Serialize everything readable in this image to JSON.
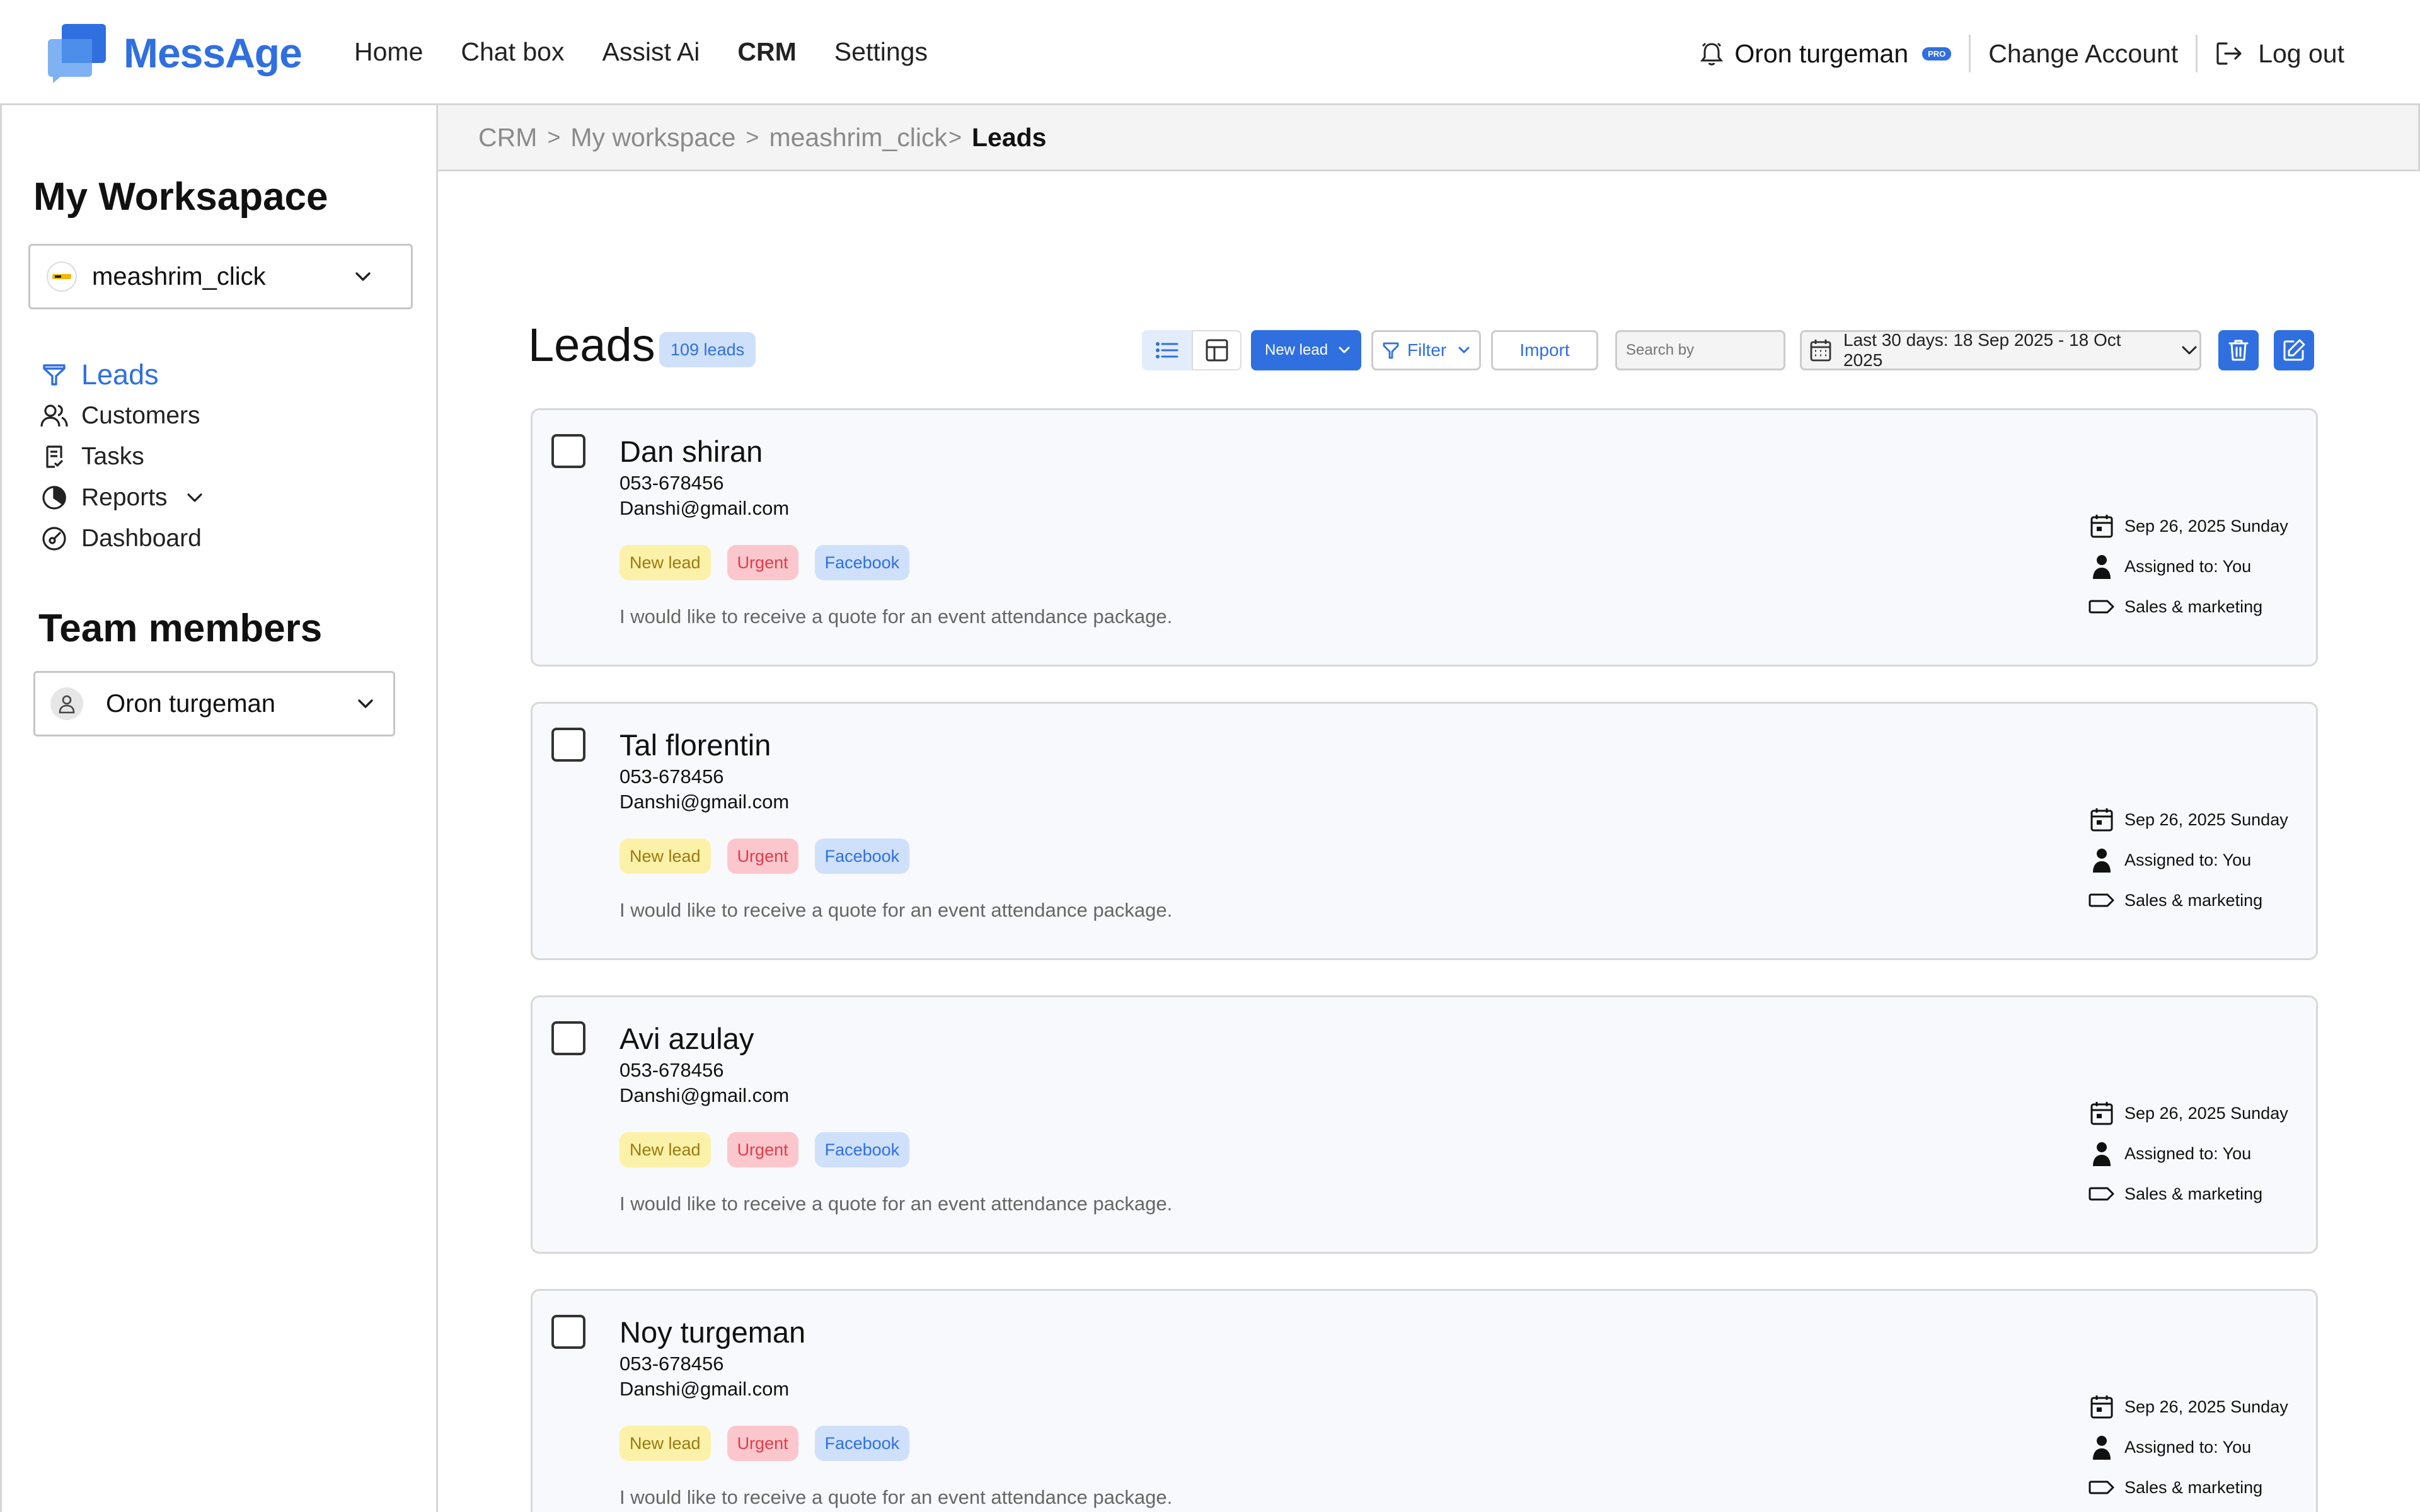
{
  "app": {
    "name": "MessAge",
    "brand_color": "#2f6fe0"
  },
  "nav": {
    "items": [
      {
        "label": "Home"
      },
      {
        "label": "Chat box"
      },
      {
        "label": "Assist Ai"
      },
      {
        "label": "CRM",
        "active": true
      },
      {
        "label": "Settings"
      }
    ]
  },
  "header": {
    "user_name": "Oron turgeman",
    "badge": "PRO",
    "change_account": "Change Account",
    "logout": "Log out"
  },
  "sidebar": {
    "workspace_title": "My Worksapace",
    "workspace_selected": "meashrim_click",
    "items": [
      {
        "label": "Leads",
        "icon": "funnel-icon",
        "active": true
      },
      {
        "label": "Customers",
        "icon": "users-icon"
      },
      {
        "label": "Tasks",
        "icon": "clipboard-icon"
      },
      {
        "label": "Reports",
        "icon": "pie-chart-icon"
      },
      {
        "label": "Dashboard",
        "icon": "gauge-icon"
      }
    ],
    "team_title": "Team members",
    "member_selected": "Oron turgeman"
  },
  "breadcrumb": {
    "items": [
      "CRM",
      "My workspace",
      "meashrim_click"
    ],
    "separator": ">",
    "current": "Leads"
  },
  "toolbar": {
    "title": "Leads",
    "count": "109 leads",
    "new_lead": "New lead",
    "filter": "Filter",
    "import": "Import",
    "search_placeholder": "Search by",
    "date_range": "Last 30 days: 18 Sep  2025 - 18 Oct 2025"
  },
  "leads": [
    {
      "name": "Dan shiran",
      "phone": "053-678456",
      "email": "Danshi@gmail.com",
      "tags": [
        "New lead",
        "Urgent",
        "Facebook"
      ],
      "note": "I would like to receive a quote for an event attendance package.",
      "date": "Sep 26, 2025 Sunday",
      "assigned": "Assigned to: You",
      "category": "Sales & marketing"
    },
    {
      "name": "Tal florentin",
      "phone": "053-678456",
      "email": "Danshi@gmail.com",
      "tags": [
        "New lead",
        "Urgent",
        "Facebook"
      ],
      "note": "I would like to receive a quote for an event attendance package.",
      "date": "Sep 26, 2025 Sunday",
      "assigned": "Assigned to: You",
      "category": "Sales & marketing"
    },
    {
      "name": "Avi azulay",
      "phone": "053-678456",
      "email": "Danshi@gmail.com",
      "tags": [
        "New lead",
        "Urgent",
        "Facebook"
      ],
      "note": "I would like to receive a quote for an event attendance package.",
      "date": "Sep 26, 2025 Sunday",
      "assigned": "Assigned to: You",
      "category": "Sales & marketing"
    },
    {
      "name": "Noy turgeman",
      "phone": "053-678456",
      "email": "Danshi@gmail.com",
      "tags": [
        "New lead",
        "Urgent",
        "Facebook"
      ],
      "note": "I would like to receive a quote for an event attendance package.",
      "date": "Sep 26, 2025 Sunday",
      "assigned": "Assigned to: You",
      "category": "Sales & marketing"
    }
  ],
  "tag_colors": {
    "New lead": "#fcf1a8",
    "Urgent": "#fbc7cc",
    "Facebook": "#cfe0fb"
  }
}
